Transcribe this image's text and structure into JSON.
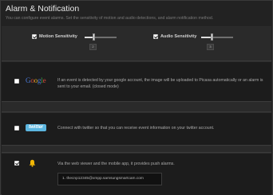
{
  "header": {
    "title": "Alarm & Notification",
    "subtitle": "You can configure event alarms. Set the sensitivity of motion and audio detections, and alarm notification method."
  },
  "sensitivity": {
    "motion": {
      "label": "Motion Sensitivity",
      "checked": true,
      "value": "2"
    },
    "audio": {
      "label": "Audio Sensitivity",
      "checked": true,
      "value": "3"
    }
  },
  "notifications": {
    "google": {
      "checked": false,
      "logo": "Google",
      "description": "If an event is detected by your google account, the image will be uploaded to Picasa automatically or an alarm is sent to your email. (closed mode)"
    },
    "twitter": {
      "checked": false,
      "logo": "twitter",
      "description": "Connect with twitter so that you can receive event information on your twitter account."
    },
    "push": {
      "checked": true,
      "icon": "bell-icon",
      "description": "Via the web viewer and the mobile app, it provides push alarms.",
      "email": "1. thecnp12345@xmpp.samsungsmartcam.com"
    }
  },
  "colors": {
    "background": "#222222",
    "bell": "#f2b705",
    "twitter": "#5cb6e0"
  }
}
